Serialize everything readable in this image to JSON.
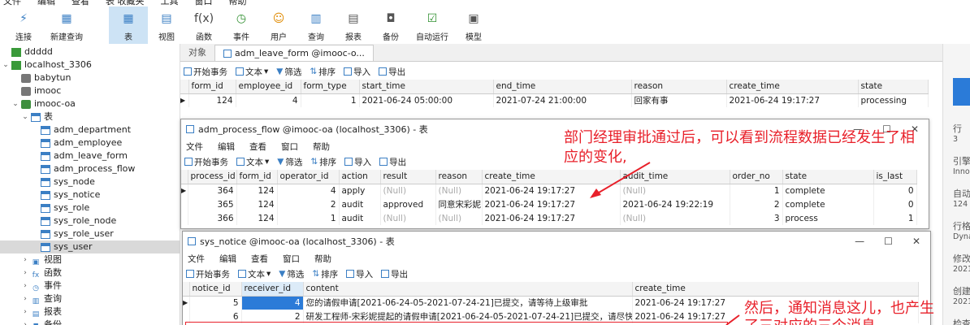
{
  "menubar": [
    "文件",
    "编辑",
    "查看",
    "表 收藏夹",
    "工具",
    "窗口",
    "帮助"
  ],
  "toolbar": [
    {
      "label": "连接",
      "icon": "plug-icon",
      "glyph": "⚡"
    },
    {
      "label": "新建查询",
      "icon": "new-query-icon",
      "glyph": "▦"
    },
    {
      "label": "表",
      "icon": "table-icon",
      "glyph": "▦",
      "active": true
    },
    {
      "label": "视图",
      "icon": "view-icon",
      "glyph": "▤"
    },
    {
      "label": "函数",
      "icon": "function-icon",
      "glyph": "f(x)"
    },
    {
      "label": "事件",
      "icon": "clock-icon",
      "glyph": "◷"
    },
    {
      "label": "用户",
      "icon": "user-icon",
      "glyph": "☺"
    },
    {
      "label": "查询",
      "icon": "query-icon",
      "glyph": "▥"
    },
    {
      "label": "报表",
      "icon": "report-icon",
      "glyph": "▤"
    },
    {
      "label": "备份",
      "icon": "backup-icon",
      "glyph": "◘"
    },
    {
      "label": "自动运行",
      "icon": "automation-icon",
      "glyph": "☑"
    },
    {
      "label": "模型",
      "icon": "model-icon",
      "glyph": "▣"
    }
  ],
  "tree": {
    "connections": [
      "ddddd",
      "localhost_3306"
    ],
    "databases": [
      "babytun",
      "imooc",
      "imooc-oa"
    ],
    "table_group": "表",
    "tables": [
      "adm_department",
      "adm_employee",
      "adm_leave_form",
      "adm_process_flow",
      "sys_node",
      "sys_notice",
      "sys_role",
      "sys_role_node",
      "sys_role_user",
      "sys_user"
    ],
    "other_groups": [
      "视图",
      "函数",
      "事件",
      "查询",
      "报表",
      "备份"
    ]
  },
  "tabs": {
    "objects": "对象",
    "active": "adm_leave_form @imooc-o..."
  },
  "grid_toolbar": {
    "begin_tx": "开始事务",
    "text": "文本",
    "filter": "筛选",
    "sort": "排序",
    "import": "导入",
    "export": "导出"
  },
  "leave_form": {
    "columns": [
      "form_id",
      "employee_id",
      "form_type",
      "start_time",
      "end_time",
      "reason",
      "create_time",
      "state"
    ],
    "rows": [
      [
        "124",
        "4",
        "1",
        "2021-06-24 05:00:00",
        "2021-07-24 21:00:00",
        "回家有事",
        "2021-06-24 19:17:27",
        "processing"
      ]
    ]
  },
  "flow_window": {
    "title": "adm_process_flow @imooc-oa (localhost_3306) - 表",
    "menu": [
      "文件",
      "编辑",
      "查看",
      "窗口",
      "帮助"
    ],
    "columns": [
      "process_id",
      "form_id",
      "operator_id",
      "action",
      "result",
      "reason",
      "create_time",
      "audit_time",
      "order_no",
      "state",
      "is_last"
    ],
    "rows": [
      [
        "364",
        "124",
        "4",
        "apply",
        "(Null)",
        "(Null)",
        "2021-06-24 19:17:27",
        "(Null)",
        "1",
        "complete",
        "0"
      ],
      [
        "365",
        "124",
        "2",
        "audit",
        "approved",
        "同意宋彩妮申",
        "2021-06-24 19:17:27",
        "2021-06-24 19:22:19",
        "2",
        "complete",
        "0"
      ],
      [
        "366",
        "124",
        "1",
        "audit",
        "(Null)",
        "(Null)",
        "2021-06-24 19:17:27",
        "(Null)",
        "3",
        "process",
        "1"
      ]
    ]
  },
  "notice_window": {
    "title": "sys_notice @imooc-oa (localhost_3306) - 表",
    "menu": [
      "文件",
      "编辑",
      "查看",
      "窗口",
      "帮助"
    ],
    "columns": [
      "notice_id",
      "receiver_id",
      "content",
      "create_time"
    ],
    "rows": [
      [
        "5",
        "4",
        "您的请假申请[2021-06-24-05-2021-07-24-21]已提交，请等待上级审批",
        "2021-06-24 19:17:27"
      ],
      [
        "6",
        "2",
        "研发工程师-宋彩妮提起的请假申请[2021-06-24-05-2021-07-24-21]已提交，请尽快审批",
        "2021-06-24 19:17:27"
      ]
    ]
  },
  "annotations": {
    "flow_line1": "部门经理审批通过后，可以看到流程数据已经发生了相",
    "flow_line2": "应的变化,",
    "notice_line1": "然后，通知消息这儿，也产生",
    "notice_line2": "了三对应的三个消息"
  },
  "right_panel": {
    "items": [
      "行",
      "引擎",
      "自动",
      "行格",
      "修改",
      "创建",
      "检查"
    ],
    "values": [
      "3",
      "Inno",
      "124",
      "Dyna",
      "2021",
      "2021"
    ]
  },
  "colors": {
    "accent": "#2b7bd8",
    "annotation": "#e8202a",
    "selected_bg": "#cde3f5"
  }
}
